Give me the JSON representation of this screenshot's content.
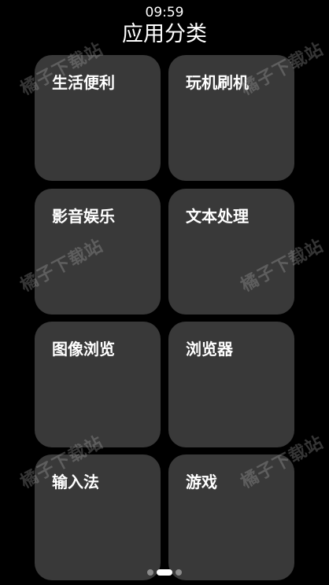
{
  "status_bar": {
    "time": "09:59"
  },
  "header": {
    "title": "应用分类"
  },
  "categories": [
    {
      "label": "生活便利"
    },
    {
      "label": "玩机刷机"
    },
    {
      "label": "影音娱乐"
    },
    {
      "label": "文本处理"
    },
    {
      "label": "图像浏览"
    },
    {
      "label": "浏览器"
    },
    {
      "label": "输入法"
    },
    {
      "label": "游戏"
    }
  ],
  "pager": {
    "page_count": 3,
    "current_page": 2
  },
  "watermark": {
    "text": "橘子下载站"
  },
  "colors": {
    "background": "#000000",
    "tile": "#393939",
    "text": "#ffffff",
    "dot_inactive": "#8a8a8a",
    "dot_active": "#ffffff"
  }
}
